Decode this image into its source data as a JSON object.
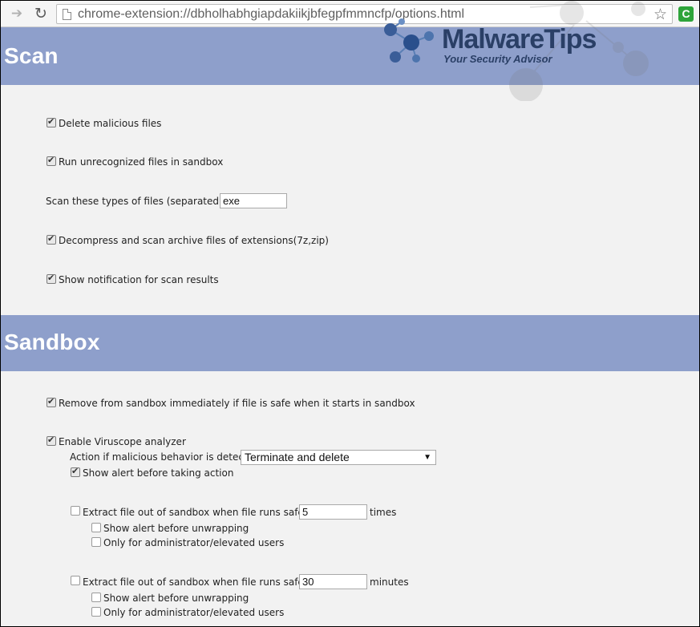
{
  "browser": {
    "url": "chrome-extension://dbholhabhgiapdakiikjbfegpfmmncfp/options.html"
  },
  "logo": {
    "brand_part1": "Malware",
    "brand_part2": "Tips",
    "tagline": "Your Security Advisor"
  },
  "scan": {
    "title": "Scan",
    "delete_malicious": {
      "label": "Delete malicious files",
      "checked": true
    },
    "run_unrecognized": {
      "label": "Run unrecognized files in sandbox",
      "checked": true
    },
    "file_types": {
      "label": "Scan these types of files (separated by ;):",
      "value": "exe"
    },
    "decompress": {
      "label": "Decompress and scan archive files of extensions(7z,zip)",
      "checked": true
    },
    "show_notification": {
      "label": "Show notification for scan results",
      "checked": true
    }
  },
  "sandbox": {
    "title": "Sandbox",
    "remove_immediately": {
      "label": "Remove from sandbox immediately if file is safe when it starts in sandbox",
      "checked": true
    },
    "enable_viruscope": {
      "label": "Enable Viruscope analyzer",
      "checked": true
    },
    "action_label": "Action if malicious behavior is detected:",
    "action_value": "Terminate and delete",
    "show_alert_before_action": {
      "label": "Show alert before taking action",
      "checked": true
    },
    "extract_times": {
      "label": "Extract file out of sandbox when file runs safely for",
      "value": "5",
      "unit": "times",
      "checked": false,
      "show_alert": "Show alert before unwrapping",
      "admin_only": "Only for administrator/elevated users"
    },
    "extract_minutes": {
      "label": "Extract file out of sandbox when file runs safely for",
      "value": "30",
      "unit": "minutes",
      "checked": false,
      "show_alert": "Show alert before unwrapping",
      "admin_only": "Only for administrator/elevated users"
    }
  }
}
